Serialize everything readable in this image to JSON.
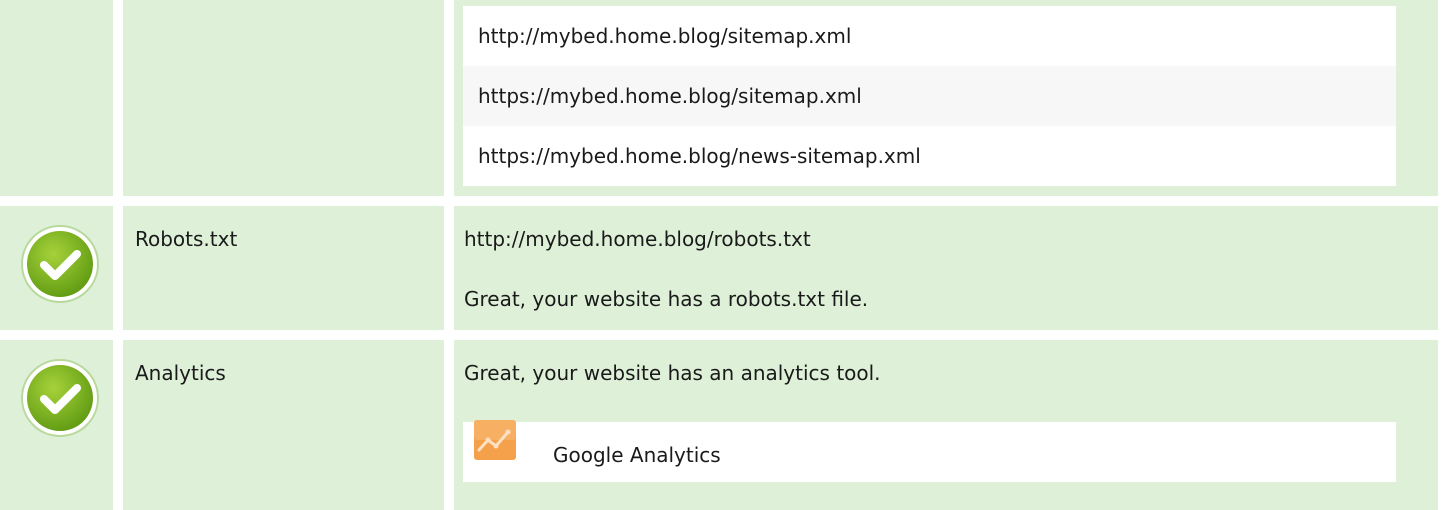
{
  "sitemaps": {
    "urls": [
      "http://mybed.home.blog/sitemap.xml",
      "https://mybed.home.blog/sitemap.xml",
      "https://mybed.home.blog/news-sitemap.xml"
    ]
  },
  "robots": {
    "status_icon": "check-circle-icon",
    "label": "Robots.txt",
    "url": "http://mybed.home.blog/robots.txt",
    "message": "Great, your website has a robots.txt file."
  },
  "analytics": {
    "status_icon": "check-circle-icon",
    "label": "Analytics",
    "message": "Great, your website has an analytics tool.",
    "tool": {
      "icon": "google-analytics-icon",
      "name": "Google Analytics"
    }
  },
  "colors": {
    "row_background": "#def0d8",
    "check_green": "#7ab51d",
    "analytics_orange": "#f5a04a"
  }
}
